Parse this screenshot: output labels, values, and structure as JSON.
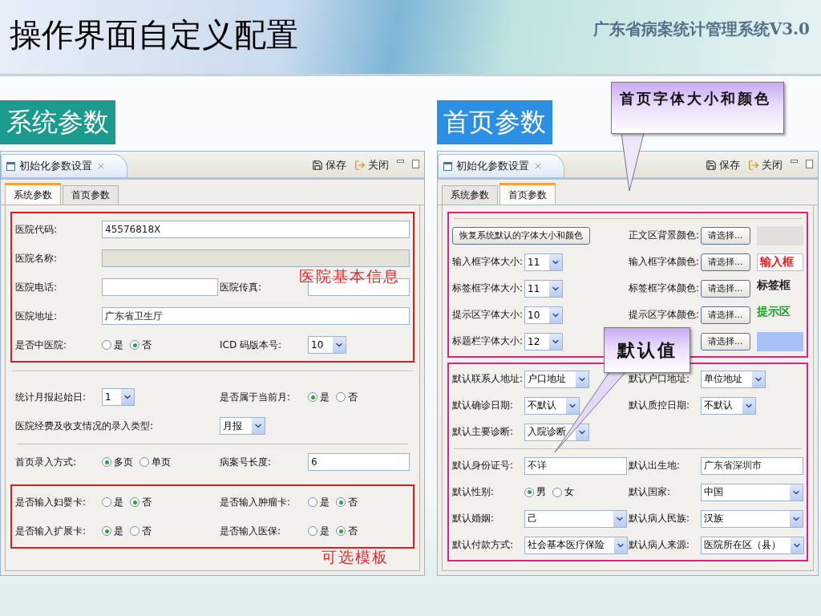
{
  "slide": {
    "title": "操作界面自定义配置",
    "subtitle": "广东省病案统计管理系统V3.0"
  },
  "panels": [
    {
      "caption": "系统参数",
      "color": "#1a9b8d",
      "window": {
        "title": "初始化参数设置",
        "actions": [
          "保存",
          "关闭"
        ],
        "tabs": [
          {
            "label": "系统参数",
            "selected": true
          },
          {
            "label": "首页参数",
            "selected": false
          }
        ]
      },
      "sections": [
        {
          "color": "#e01b1b",
          "note": {
            "text": "医院基本信息",
            "kind": "overlay"
          },
          "groups": [
            [
              {
                "fields": [
                  {
                    "label": "医院代码:",
                    "kind": "text",
                    "value": "45576818X",
                    "disabled": false
                  }
                ]
              },
              {
                "fields": [
                  {
                    "label": "医院名称:",
                    "kind": "text",
                    "disabled": true
                  }
                ]
              },
              {
                "fields": [
                  {
                    "label": "医院电话:",
                    "kind": "text",
                    "disabled": false
                  },
                  {
                    "label": "医院传真:",
                    "kind": "text",
                    "disabled": false
                  }
                ]
              },
              {
                "fields": [
                  {
                    "label": "医院地址:",
                    "kind": "text",
                    "value": "广东省卫生厅",
                    "disabled": false
                  }
                ]
              },
              {
                "fields": [
                  {
                    "label": "是否中医院:",
                    "kind": "radio",
                    "options": [
                      {
                        "label": "是",
                        "selected": false
                      },
                      {
                        "label": "否",
                        "selected": true
                      }
                    ]
                  },
                  {
                    "label": "ICD 码版本号:",
                    "kind": "combo",
                    "value": "10"
                  }
                ]
              }
            ]
          ]
        },
        {
          "groups": [
            [
              {
                "fields": [
                  {
                    "label": "统计月报起始日:",
                    "kind": "combo",
                    "value": "1"
                  },
                  {
                    "label": "是否属于当前月:",
                    "kind": "radio",
                    "options": [
                      {
                        "label": "是",
                        "selected": true
                      },
                      {
                        "label": "否",
                        "selected": false
                      }
                    ]
                  }
                ]
              },
              {
                "fields": [
                  {
                    "label": "医院经费及收支情况的录入类型:",
                    "kind": "combo",
                    "value": "月报",
                    "long_label": true
                  }
                ]
              }
            ],
            [
              {
                "fields": [
                  {
                    "label": "首页录入方式:",
                    "kind": "radio",
                    "options": [
                      {
                        "label": "多页",
                        "selected": true
                      },
                      {
                        "label": "单页",
                        "selected": false
                      }
                    ]
                  },
                  {
                    "label": "病案号长度:",
                    "kind": "text",
                    "value": "6",
                    "disabled": false
                  }
                ]
              }
            ]
          ]
        },
        {
          "color": "#e01b1b",
          "note": {
            "text": "可选模板",
            "kind": "below"
          },
          "groups": [
            [
              {
                "fields": [
                  {
                    "label": "是否输入妇婴卡:",
                    "kind": "radio",
                    "options": [
                      {
                        "label": "是",
                        "selected": false
                      },
                      {
                        "label": "否",
                        "selected": true
                      }
                    ]
                  },
                  {
                    "label": "是否输入肿瘤卡:",
                    "kind": "radio",
                    "options": [
                      {
                        "label": "是",
                        "selected": false
                      },
                      {
                        "label": "否",
                        "selected": true
                      }
                    ]
                  }
                ]
              },
              {
                "fields": [
                  {
                    "label": "是否输入扩展卡:",
                    "kind": "radio",
                    "options": [
                      {
                        "label": "是",
                        "selected": true
                      },
                      {
                        "label": "否",
                        "selected": false
                      }
                    ]
                  },
                  {
                    "label": "是否输入医保:",
                    "kind": "radio",
                    "options": [
                      {
                        "label": "是",
                        "selected": false
                      },
                      {
                        "label": "否",
                        "selected": true
                      }
                    ]
                  }
                ]
              }
            ]
          ]
        }
      ]
    },
    {
      "caption": "首页参数",
      "color": "#2b8fe3",
      "window": {
        "title": "初始化参数设置",
        "actions": [
          "保存",
          "关闭"
        ],
        "tabs": [
          {
            "label": "系统参数",
            "selected": false
          },
          {
            "label": "首页参数",
            "selected": true
          }
        ]
      },
      "sections": [
        {
          "color": "#e0207c",
          "top_rule": true,
          "groups": [
            [
              {
                "fields": [
                  {
                    "kind": "button",
                    "value": "恢复系统默认的字体大小和颜色"
                  },
                  {
                    "label": "正文区背景颜色:",
                    "kind": "color",
                    "button": "请选择...",
                    "sample": {
                      "kind": "swatch",
                      "color": "#e2e0da"
                    }
                  }
                ]
              },
              {
                "fields": [
                  {
                    "label": "输入框字体大小:",
                    "kind": "combo",
                    "value": "11"
                  },
                  {
                    "label": "输入框字体颜色:",
                    "kind": "color",
                    "button": "请选择...",
                    "sample": {
                      "kind": "field",
                      "text": "输入框",
                      "color": "#f01818"
                    }
                  }
                ]
              },
              {
                "fields": [
                  {
                    "label": "标签框字体大小:",
                    "kind": "combo",
                    "value": "11"
                  },
                  {
                    "label": "标签框字体颜色:",
                    "kind": "color",
                    "button": "请选择...",
                    "sample": {
                      "kind": "label",
                      "text": "标签框",
                      "color": "#222222"
                    }
                  }
                ]
              },
              {
                "fields": [
                  {
                    "label": "提示区字体大小:",
                    "kind": "combo",
                    "value": "10"
                  },
                  {
                    "label": "提示区字体颜色:",
                    "kind": "color",
                    "button": "请选择...",
                    "sample": {
                      "kind": "label",
                      "text": "提示区",
                      "color": "#1e9a2a"
                    }
                  }
                ]
              },
              {
                "fields": [
                  {
                    "label": "标题栏字体大小:",
                    "kind": "combo",
                    "value": "12"
                  },
                  {
                    "kind": "color",
                    "button": "请选择...",
                    "sample": {
                      "kind": "swatch",
                      "color": "#a5c1f5"
                    }
                  }
                ]
              }
            ]
          ]
        },
        {
          "color": "#e0207c",
          "groups": [
            [
              {
                "fields": [
                  {
                    "label": "默认联系人地址:",
                    "kind": "combo",
                    "value": "户口地址"
                  },
                  {
                    "label": "默认户口地址:",
                    "kind": "combo",
                    "value": "单位地址"
                  }
                ]
              },
              {
                "fields": [
                  {
                    "label": "默认确诊日期:",
                    "kind": "combo",
                    "value": "不默认"
                  },
                  {
                    "label": "默认质控日期:",
                    "kind": "combo",
                    "value": "不默认"
                  }
                ]
              },
              {
                "fields": [
                  {
                    "label": "默认主要诊断:",
                    "kind": "combo",
                    "value": "入院诊断"
                  }
                ]
              }
            ],
            [
              {
                "fields": [
                  {
                    "label": "默认身份证号:",
                    "kind": "text",
                    "value": "不详",
                    "disabled": false
                  },
                  {
                    "label": "默认出生地:",
                    "kind": "text",
                    "value": "广东省深圳市",
                    "disabled": false
                  }
                ]
              },
              {
                "fields": [
                  {
                    "label": "默认性别:",
                    "kind": "radio",
                    "options": [
                      {
                        "label": "男",
                        "selected": true
                      },
                      {
                        "label": "女",
                        "selected": false
                      }
                    ]
                  },
                  {
                    "label": "默认国家:",
                    "kind": "combo",
                    "value": "中国",
                    "wide": true
                  }
                ]
              },
              {
                "fields": [
                  {
                    "label": "默认婚姻:",
                    "kind": "combo",
                    "value": "己",
                    "wide": true
                  },
                  {
                    "label": "默认病人民族:",
                    "kind": "combo",
                    "value": "汉族",
                    "wide": true
                  }
                ]
              },
              {
                "fields": [
                  {
                    "label": "默认付款方式:",
                    "kind": "combo",
                    "value": "社会基本医疗保险",
                    "wide": true
                  },
                  {
                    "label": "默认病人来源:",
                    "kind": "combo",
                    "value": "医院所在区（县）",
                    "wide": true
                  }
                ]
              }
            ]
          ]
        }
      ]
    }
  ],
  "callouts": [
    {
      "text": "首页字体大小和颜色"
    },
    {
      "text": "默认值"
    }
  ]
}
